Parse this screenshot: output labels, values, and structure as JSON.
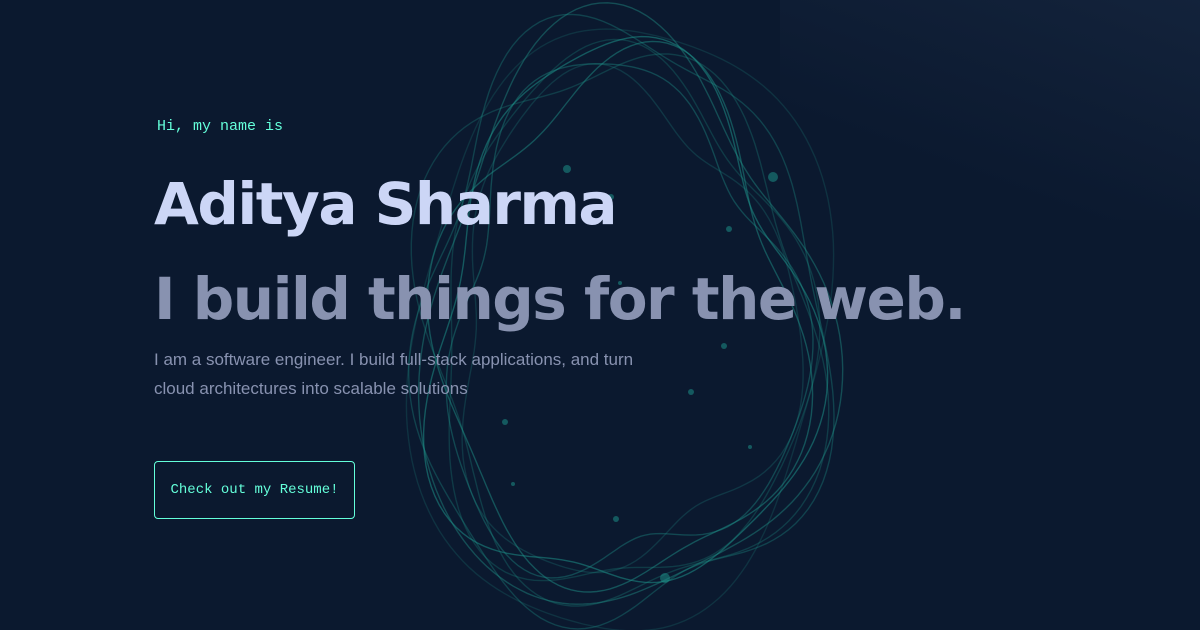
{
  "hero": {
    "greeting": "Hi, my name is",
    "name": "Aditya Sharma",
    "tagline": "I build things for the web.",
    "intro": "I am a software engineer. I build full-stack applications, and turn cloud architectures into scalable solutions",
    "resume_button_label": "Check out my Resume!"
  },
  "colors": {
    "background": "#0b192f",
    "accent": "#64ffda",
    "heading": "#ccd6f6",
    "text": "#8892b0",
    "rings": "#1e8e86"
  }
}
